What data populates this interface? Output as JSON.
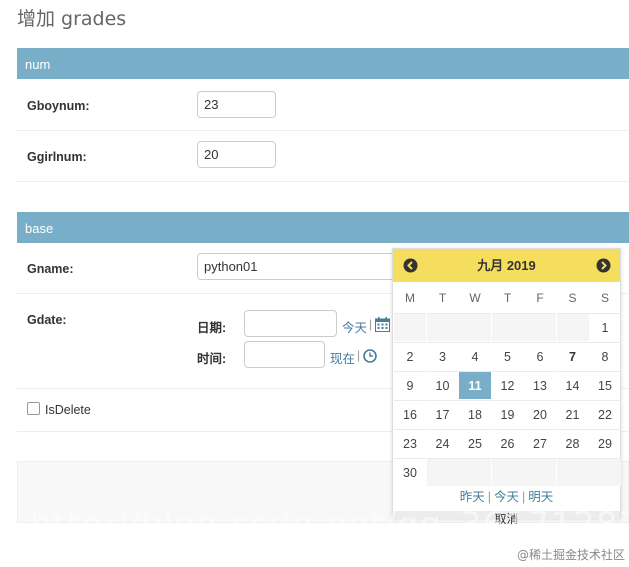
{
  "page": {
    "title": "增加 grades"
  },
  "sections": {
    "num": {
      "header": "num",
      "fields": {
        "gboynum": {
          "label": "Gboynum:",
          "value": "23"
        },
        "ggirlnum": {
          "label": "Ggirlnum:",
          "value": "20"
        }
      }
    },
    "base": {
      "header": "base",
      "gname": {
        "label": "Gname:",
        "value": "python01"
      },
      "gdate": {
        "label": "Gdate:",
        "date_label": "日期:",
        "date_value": "",
        "today_link": "今天",
        "time_label": "时间:",
        "time_value": "",
        "now_link": "现在",
        "separator": "|"
      },
      "isdelete": {
        "label": "IsDelete",
        "checked": false
      }
    }
  },
  "calendar": {
    "caption": "九月 2019",
    "weekdays": [
      "M",
      "T",
      "W",
      "T",
      "F",
      "S",
      "S"
    ],
    "weeks": [
      [
        "",
        "",
        "",
        "",
        "",
        "",
        "1"
      ],
      [
        "2",
        "3",
        "4",
        "5",
        "6",
        "7",
        "8"
      ],
      [
        "9",
        "10",
        "11",
        "12",
        "13",
        "14",
        "15"
      ],
      [
        "16",
        "17",
        "18",
        "19",
        "20",
        "21",
        "22"
      ],
      [
        "23",
        "24",
        "25",
        "26",
        "27",
        "28",
        "29"
      ],
      [
        "30",
        "",
        "",
        "",
        "",
        "",
        ""
      ]
    ],
    "selected_day": "11",
    "bold_day": "7",
    "shortcuts": {
      "yesterday": "昨天",
      "today": "今天",
      "tomorrow": "明天",
      "separator": "|"
    },
    "cancel_label": "取消",
    "accent_color": "#f5dd5d",
    "selected_color": "#79aec8"
  },
  "colors": {
    "module_header": "#79aec8",
    "link": "#447e9b"
  },
  "watermark": {
    "text": "http://blog.csdn.net/qq_36171287"
  },
  "credit": {
    "text": "@稀土掘金技术社区"
  }
}
